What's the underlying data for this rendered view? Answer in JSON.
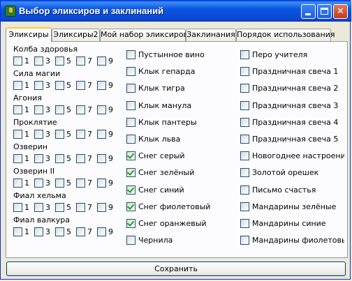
{
  "window": {
    "title": "Выбор эликсиров и заклинаний"
  },
  "tabs": [
    "Эликсиры",
    "Эликсиры2",
    "Мой набор эликсиров",
    "Заклинания",
    "Порядок использования"
  ],
  "active_tab": 0,
  "groups": [
    {
      "label": "Колба здоровья",
      "options": [
        {
          "label": "1",
          "checked": false
        },
        {
          "label": "3",
          "checked": false
        },
        {
          "label": "5",
          "checked": false
        },
        {
          "label": "7",
          "checked": false
        },
        {
          "label": "9",
          "checked": false
        }
      ]
    },
    {
      "label": "Сила магии",
      "options": [
        {
          "label": "1",
          "checked": false
        },
        {
          "label": "3",
          "checked": false
        },
        {
          "label": "5",
          "checked": false
        },
        {
          "label": "7",
          "checked": false
        },
        {
          "label": "9",
          "checked": false
        }
      ]
    },
    {
      "label": "Агония",
      "options": [
        {
          "label": "1",
          "checked": false
        },
        {
          "label": "3",
          "checked": false
        },
        {
          "label": "5",
          "checked": false
        },
        {
          "label": "7",
          "checked": false
        },
        {
          "label": "9",
          "checked": false
        }
      ]
    },
    {
      "label": "Проклятие",
      "options": [
        {
          "label": "1",
          "checked": false
        },
        {
          "label": "3",
          "checked": false
        },
        {
          "label": "5",
          "checked": false
        },
        {
          "label": "7",
          "checked": false
        },
        {
          "label": "9",
          "checked": false
        }
      ]
    },
    {
      "label": "Озверин",
      "options": [
        {
          "label": "1",
          "checked": false
        },
        {
          "label": "3",
          "checked": false
        },
        {
          "label": "5",
          "checked": false
        },
        {
          "label": "7",
          "checked": false
        },
        {
          "label": "9",
          "checked": false
        }
      ]
    },
    {
      "label": "Озверин II",
      "options": [
        {
          "label": "1",
          "checked": false
        },
        {
          "label": "3",
          "checked": false
        },
        {
          "label": "5",
          "checked": false
        },
        {
          "label": "7",
          "checked": false
        },
        {
          "label": "9",
          "checked": false
        }
      ]
    },
    {
      "label": "Фиал хельма",
      "options": [
        {
          "label": "1",
          "checked": false
        },
        {
          "label": "3",
          "checked": false
        },
        {
          "label": "5",
          "checked": false
        },
        {
          "label": "7",
          "checked": false
        },
        {
          "label": "9",
          "checked": false
        }
      ]
    },
    {
      "label": "Фиал валкура",
      "options": [
        {
          "label": "1",
          "checked": false
        },
        {
          "label": "3",
          "checked": false
        },
        {
          "label": "5",
          "checked": false
        },
        {
          "label": "7",
          "checked": false
        },
        {
          "label": "9",
          "checked": false
        }
      ]
    }
  ],
  "column2": [
    {
      "label": "Пустынное вино",
      "checked": false
    },
    {
      "label": "Клык гепарда",
      "checked": false
    },
    {
      "label": "Клык тигра",
      "checked": false
    },
    {
      "label": "Клык манула",
      "checked": false
    },
    {
      "label": "Клык пантеры",
      "checked": false
    },
    {
      "label": "Клык льва",
      "checked": false
    },
    {
      "label": "Снег серый",
      "checked": true
    },
    {
      "label": "Снег зелёный",
      "checked": true
    },
    {
      "label": "Снег синий",
      "checked": true
    },
    {
      "label": "Снег фиолетовый",
      "checked": true
    },
    {
      "label": "Снег оранжевый",
      "checked": true
    },
    {
      "label": "Чернила",
      "checked": false
    }
  ],
  "column3": [
    {
      "label": "Перо учителя",
      "checked": false
    },
    {
      "label": "Праздничная свеча 1",
      "checked": false
    },
    {
      "label": "Праздничная свеча 2",
      "checked": false
    },
    {
      "label": "Праздничная свеча 3",
      "checked": false
    },
    {
      "label": "Праздничная свеча 4",
      "checked": false
    },
    {
      "label": "Праздничная свеча 5",
      "checked": false
    },
    {
      "label": "Новогоднее настроени",
      "checked": false
    },
    {
      "label": "Золотой орешек",
      "checked": false
    },
    {
      "label": "Письмо счастья",
      "checked": false
    },
    {
      "label": "Мандарины зелёные",
      "checked": false
    },
    {
      "label": "Мандарины синие",
      "checked": false
    },
    {
      "label": "Мандарины фиолетовы",
      "checked": false
    }
  ],
  "save_button": {
    "label": "Сохранить"
  },
  "icons": {
    "app": "potion-icon",
    "minimize": "minimize-icon",
    "maximize": "maximize-icon",
    "close": "close-icon"
  },
  "colors": {
    "titlebar": "#0a55df",
    "check": "#21a121",
    "active_tab_accent": "#ffc83c"
  }
}
